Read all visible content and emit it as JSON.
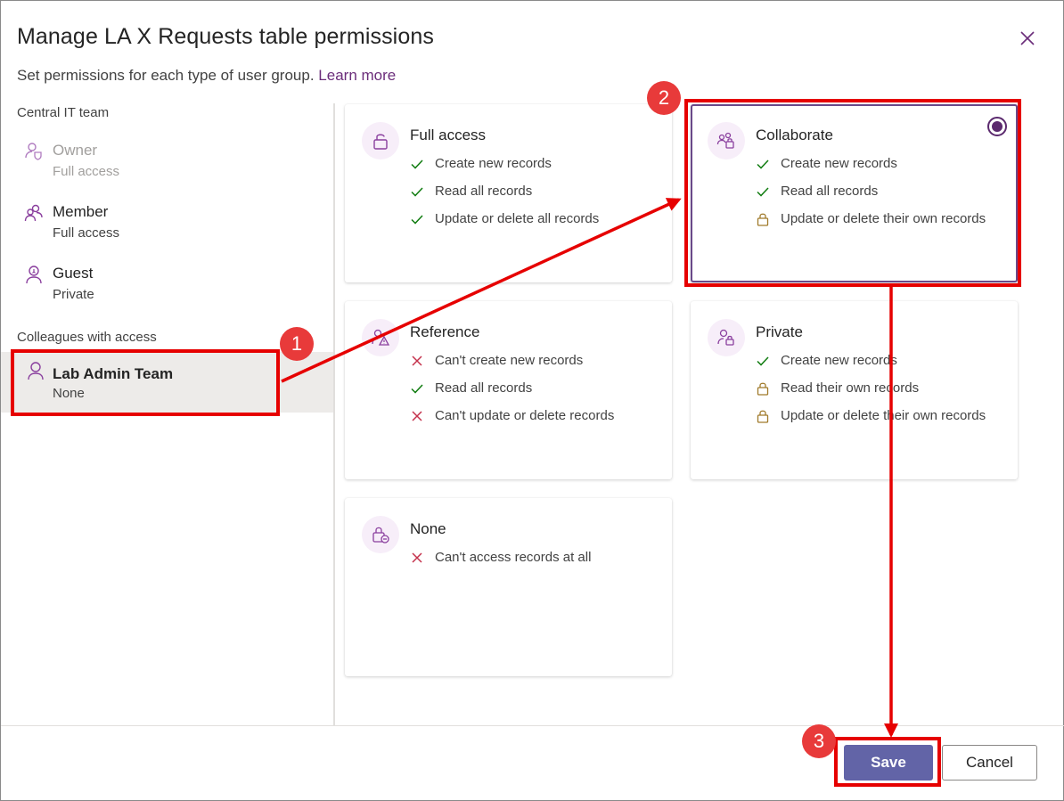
{
  "dialog": {
    "title": "Manage LA X Requests table permissions",
    "subtitle": "Set permissions for each type of user group.",
    "learn_more": "Learn more"
  },
  "sidebar": {
    "group1_label": "Central IT team",
    "group2_label": "Colleagues with access",
    "users": [
      {
        "name": "Owner",
        "access": "Full access"
      },
      {
        "name": "Member",
        "access": "Full access"
      },
      {
        "name": "Guest",
        "access": "Private"
      },
      {
        "name": "Lab Admin Team",
        "access": "None"
      }
    ]
  },
  "cards": [
    {
      "title": "Full access",
      "lines": [
        "Create new records",
        "Read all records",
        "Update or delete all records"
      ],
      "icons": [
        "check",
        "check",
        "check"
      ]
    },
    {
      "title": "Collaborate",
      "lines": [
        "Create new records",
        "Read all records",
        "Update or delete their own records"
      ],
      "icons": [
        "check",
        "check",
        "lock"
      ],
      "selected": true
    },
    {
      "title": "Reference",
      "lines": [
        "Can't create new records",
        "Read all records",
        "Can't update or delete records"
      ],
      "icons": [
        "cross",
        "check",
        "cross"
      ]
    },
    {
      "title": "Private",
      "lines": [
        "Create new records",
        "Read their own records",
        "Update or delete their own records"
      ],
      "icons": [
        "check",
        "lock",
        "lock"
      ]
    },
    {
      "title": "None",
      "lines": [
        "Can't access records at all"
      ],
      "icons": [
        "cross"
      ]
    }
  ],
  "footer": {
    "save_label": "Save",
    "cancel_label": "Cancel"
  },
  "annotations": {
    "badge1": "1",
    "badge2": "2",
    "badge3": "3"
  },
  "colors": {
    "accent": "#6264a7",
    "purple_icon": "#8a3f9e",
    "check": "#107c10",
    "cross": "#c4314b",
    "lock": "#a07a2a",
    "highlight": "#e60000"
  }
}
